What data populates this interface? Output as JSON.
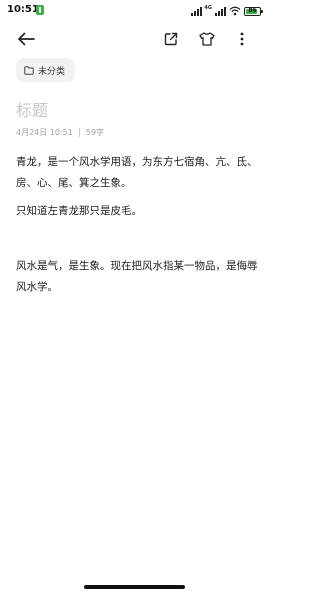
{
  "status_bar": {
    "time": "10:51",
    "battery": {
      "label": "86",
      "level_percent": 86,
      "color": "#3cb043"
    },
    "notification_badge_color": "#3cb043"
  },
  "toolbar": {
    "back_icon": "arrow-left-icon",
    "share_icon": "share-out-icon",
    "theme_icon": "shirt-icon",
    "more_icon": "more-vertical-icon"
  },
  "note": {
    "category": "未分类",
    "title_placeholder": "标题",
    "date": "4月24日 10:51",
    "char_count": "59字",
    "paragraphs": [
      "青龙，是一个风水学用语，为东方七宿角、亢、氐、房、心、尾、箕之生象。",
      "只知道左青龙那只是皮毛。",
      "风水是气，是生象。现在把风水指某一物品，是侮辱风水学。"
    ]
  }
}
